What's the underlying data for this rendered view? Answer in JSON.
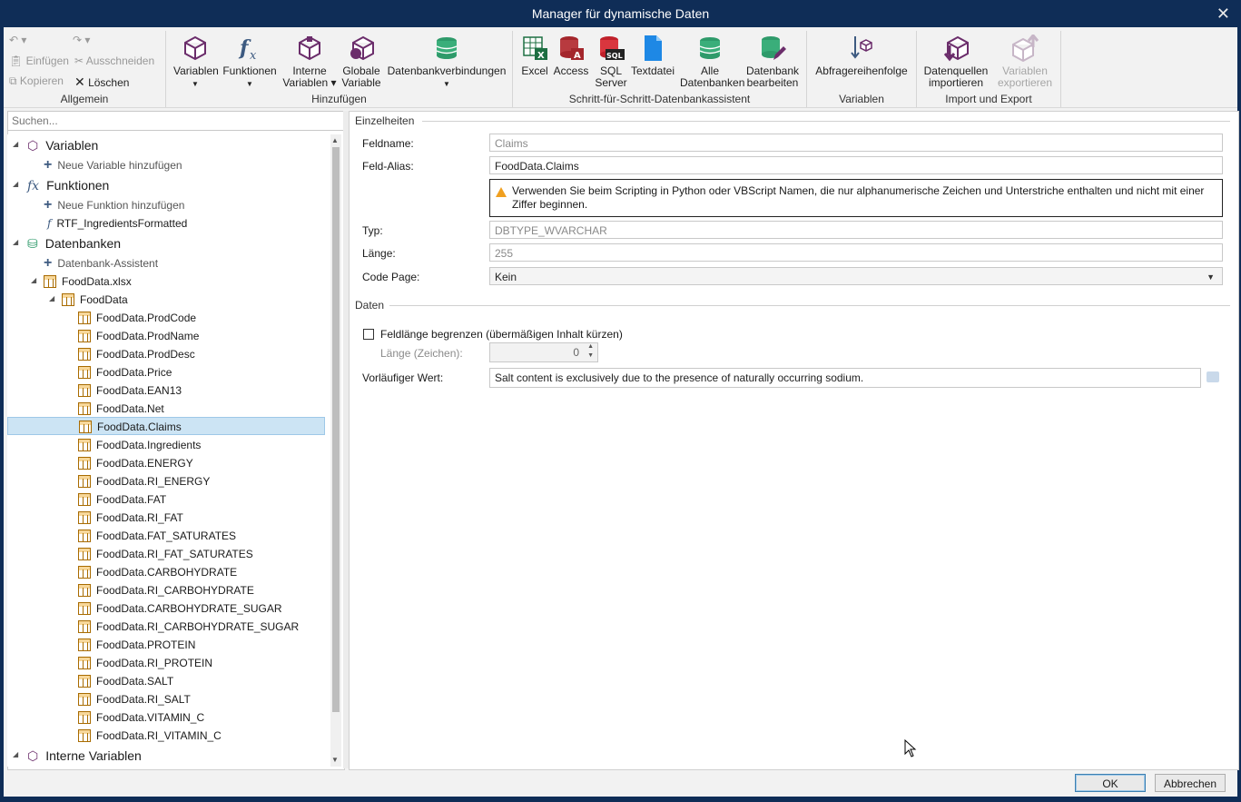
{
  "window": {
    "title": "Manager für dynamische Daten",
    "close_glyph": "✕"
  },
  "ribbon": {
    "allgemein": {
      "label": "Allgemein",
      "paste": "Einfügen",
      "cut": "Ausschneiden",
      "copy": "Kopieren",
      "delete": "Löschen"
    },
    "hinzufuegen": {
      "label": "Hinzufügen",
      "variablen": "Variablen",
      "funktionen": "Funktionen",
      "interne_1": "Interne",
      "interne_2": "Variablen",
      "globale_1": "Globale",
      "globale_2": "Variable",
      "dbverb": "Datenbankverbindungen"
    },
    "assistent": {
      "label": "Schritt-für-Schritt-Datenbankassistent",
      "excel": "Excel",
      "access": "Access",
      "sql_1": "SQL",
      "sql_2": "Server",
      "textdatei": "Textdatei",
      "alle_1": "Alle",
      "alle_2": "Datenbanken",
      "bearb_1": "Datenbank",
      "bearb_2": "bearbeiten"
    },
    "variablen": {
      "label": "Variablen",
      "reihenfolge": "Abfragereihenfolge"
    },
    "import_export": {
      "label": "Import und Export",
      "import_1": "Datenquellen",
      "import_2": "importieren",
      "export_1": "Variablen",
      "export_2": "exportieren"
    }
  },
  "search": {
    "placeholder": "Suchen..."
  },
  "tree": {
    "variablen": "Variablen",
    "neue_variable": "Neue Variable hinzufügen",
    "funktionen": "Funktionen",
    "neue_funktion": "Neue Funktion hinzufügen",
    "rtf": "RTF_IngredientsFormatted",
    "datenbanken": "Datenbanken",
    "assistent": "Datenbank-Assistent",
    "file": "FoodData.xlsx",
    "table": "FoodData",
    "fields": [
      "FoodData.ProdCode",
      "FoodData.ProdName",
      "FoodData.ProdDesc",
      "FoodData.Price",
      "FoodData.EAN13",
      "FoodData.Net",
      "FoodData.Claims",
      "FoodData.Ingredients",
      "FoodData.ENERGY",
      "FoodData.RI_ENERGY",
      "FoodData.FAT",
      "FoodData.RI_FAT",
      "FoodData.FAT_SATURATES",
      "FoodData.RI_FAT_SATURATES",
      "FoodData.CARBOHYDRATE",
      "FoodData.RI_CARBOHYDRATE",
      "FoodData.CARBOHYDRATE_SUGAR",
      "FoodData.RI_CARBOHYDRATE_SUGAR",
      "FoodData.PROTEIN",
      "FoodData.RI_PROTEIN",
      "FoodData.SALT",
      "FoodData.RI_SALT",
      "FoodData.VITAMIN_C",
      "FoodData.RI_VITAMIN_C"
    ],
    "selected": "FoodData.Claims",
    "interne": "Interne Variablen"
  },
  "details": {
    "section": "Einzelheiten",
    "feldname_label": "Feldname:",
    "feldname": "Claims",
    "alias_label": "Feld-Alias:",
    "alias": "FoodData.Claims",
    "warning": "Verwenden Sie beim Scripting in Python oder VBScript Namen, die nur alphanumerische Zeichen und Unterstriche enthalten und nicht mit einer Ziffer beginnen.",
    "typ_label": "Typ:",
    "typ": "DBTYPE_WVARCHAR",
    "laenge_label": "Länge:",
    "laenge": "255",
    "codepage_label": "Code Page:",
    "codepage": "Kein"
  },
  "daten": {
    "section": "Daten",
    "limit_label": "Feldlänge begrenzen (übermäßigen Inhalt kürzen)",
    "limit_checked": false,
    "zeichen_label": "Länge (Zeichen):",
    "zeichen": "0",
    "vorl_label": "Vorläufiger Wert:",
    "vorl": "Salt content is exclusively due to the presence of naturally occurring sodium."
  },
  "buttons": {
    "ok": "OK",
    "cancel": "Abbrechen"
  }
}
